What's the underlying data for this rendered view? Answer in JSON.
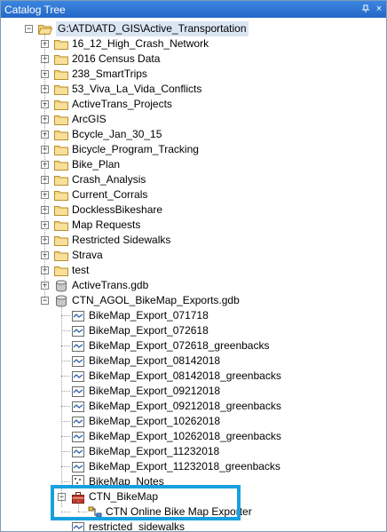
{
  "window": {
    "title": "Catalog Tree",
    "pin_glyph": "ᵖ",
    "close_glyph": "×"
  },
  "tree": {
    "root": "G:\\ATD\\ATD_GIS\\Active_Transportation",
    "folders": [
      "16_12_High_Crash_Network",
      "2016 Census Data",
      "238_SmartTrips",
      "53_Viva_La_Vida_Conflicts",
      "ActiveTrans_Projects",
      "ArcGIS",
      "Bcycle_Jan_30_15",
      "Bicycle_Program_Tracking",
      "Bike_Plan",
      "Crash_Analysis",
      "Current_Corrals",
      "DocklessBikeshare",
      "Map Requests",
      "Restricted Sidewalks",
      "Strava",
      "test"
    ],
    "gdb1": "ActiveTrans.gdb",
    "gdb2": "CTN_AGOL_BikeMap_Exports.gdb",
    "gdb2_items": [
      "BikeMap_Export_071718",
      "BikeMap_Export_072618",
      "BikeMap_Export_072618_greenbacks",
      "BikeMap_Export_08142018",
      "BikeMap_Export_08142018_greenbacks",
      "BikeMap_Export_09212018",
      "BikeMap_Export_09212018_greenbacks",
      "BikeMap_Export_10262018",
      "BikeMap_Export_10262018_greenbacks",
      "BikeMap_Export_11232018",
      "BikeMap_Export_11232018_greenbacks",
      "BikeMap_Notes"
    ],
    "toolbox": "CTN_BikeMap",
    "tool": "CTN Online Bike Map Exporter",
    "last_item": "restricted_sidewalks",
    "expand_glyph": "+",
    "collapse_glyph": "−"
  },
  "colors": {
    "titlebar": "#2467c7",
    "highlight": "#18a0e0",
    "folder": "#f4d27a",
    "selection": "#dbe6f4"
  }
}
